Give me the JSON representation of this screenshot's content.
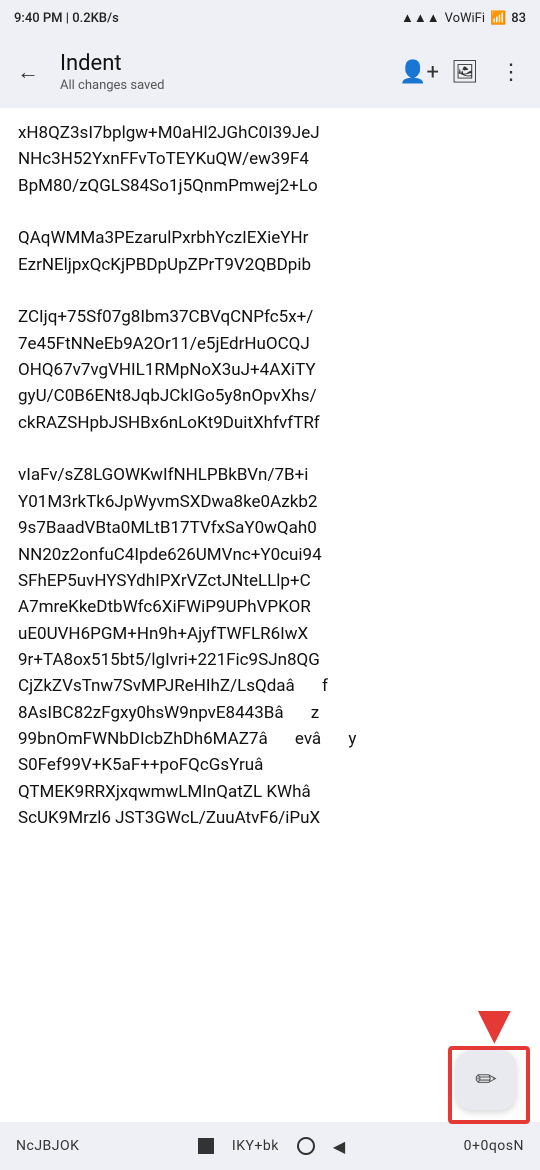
{
  "statusBar": {
    "time": "9:40 PM",
    "data": "0.2KB/s",
    "battery": "83"
  },
  "topBar": {
    "title": "Indent",
    "subtitle": "All changes saved",
    "backLabel": "back"
  },
  "actions": {
    "addPerson": "add-person",
    "comment": "comment",
    "more": "more"
  },
  "content": {
    "text": "xH8QZ3sI7bplgw+M0aHl2JGhC0I39JeJ\nNHc3H52YxnFFvToTEYKuQW/ew39F4\nBpM80/zQGLS84So1j5QnmPmwej2+Lo\n\nQAqWMMa3PEzarulPxrbhYczIEXieYHr\nEzrNEljpxQcKjPBDpUpZPrT9V2QBDpib\n\nZCIjq+75Sf07g8Ibm37CBVqCNPfc5x+/\n7e45FtNNeEb9A2Or11/e5jEdrHuOCQJ\nOHQ67v7vgVHIL1RMpNoX3uJ+4AXiTY\ngyU/C0B6ENt8JqbJCkIGo5y8nOpvXhs/\nckRAZSHpbJSHBx6nLoKt9DuitXhfvfTRf\n\nvIaFv/sZ8LGOWKwIfNHLPBkBVn/7B+i\nY01M3rkTk6JpWyvmSXDwa8ke0Azkb2\n9s7BaadVBta0MLtB17TVfxSaY0wQah0\nNN20z2onfuC4Ipde626UMVnc+Y0cui94\nSFhEP5uvHYSYdhIPXrVZctJNteLLlp+C\nA7mreKkeDtbWfc6XiFWiP9UPhVPKOR\nuE0UVH6PGM+Hn9h+AjyfTWFLR6IwX\n9r+TA8ox515bt5/lgIvri+221Fic9SJn8QG\nCjZkZVsTnw7SvMPJReHIhZ/LsQdaâf\n8AsIBC82zFgxy0hsW9npvE8443Bâz\n99bnOmFWNbDIcbZhDh6MAZ7âevây\nS0Fef99V+K5aF++poFQcGsYruâ\nQTMEK9RRXjxqwmwLMInQatZL KWhâ\nScUK9Mrzl6 JST3GWcL/ZuuAtvF6/iPuX"
  },
  "bottomNav": {
    "leftText": "NcJBJOK",
    "rightText": "0+0qosN",
    "middleText": "IKY+bk"
  },
  "fab": {
    "icon": "✏"
  }
}
